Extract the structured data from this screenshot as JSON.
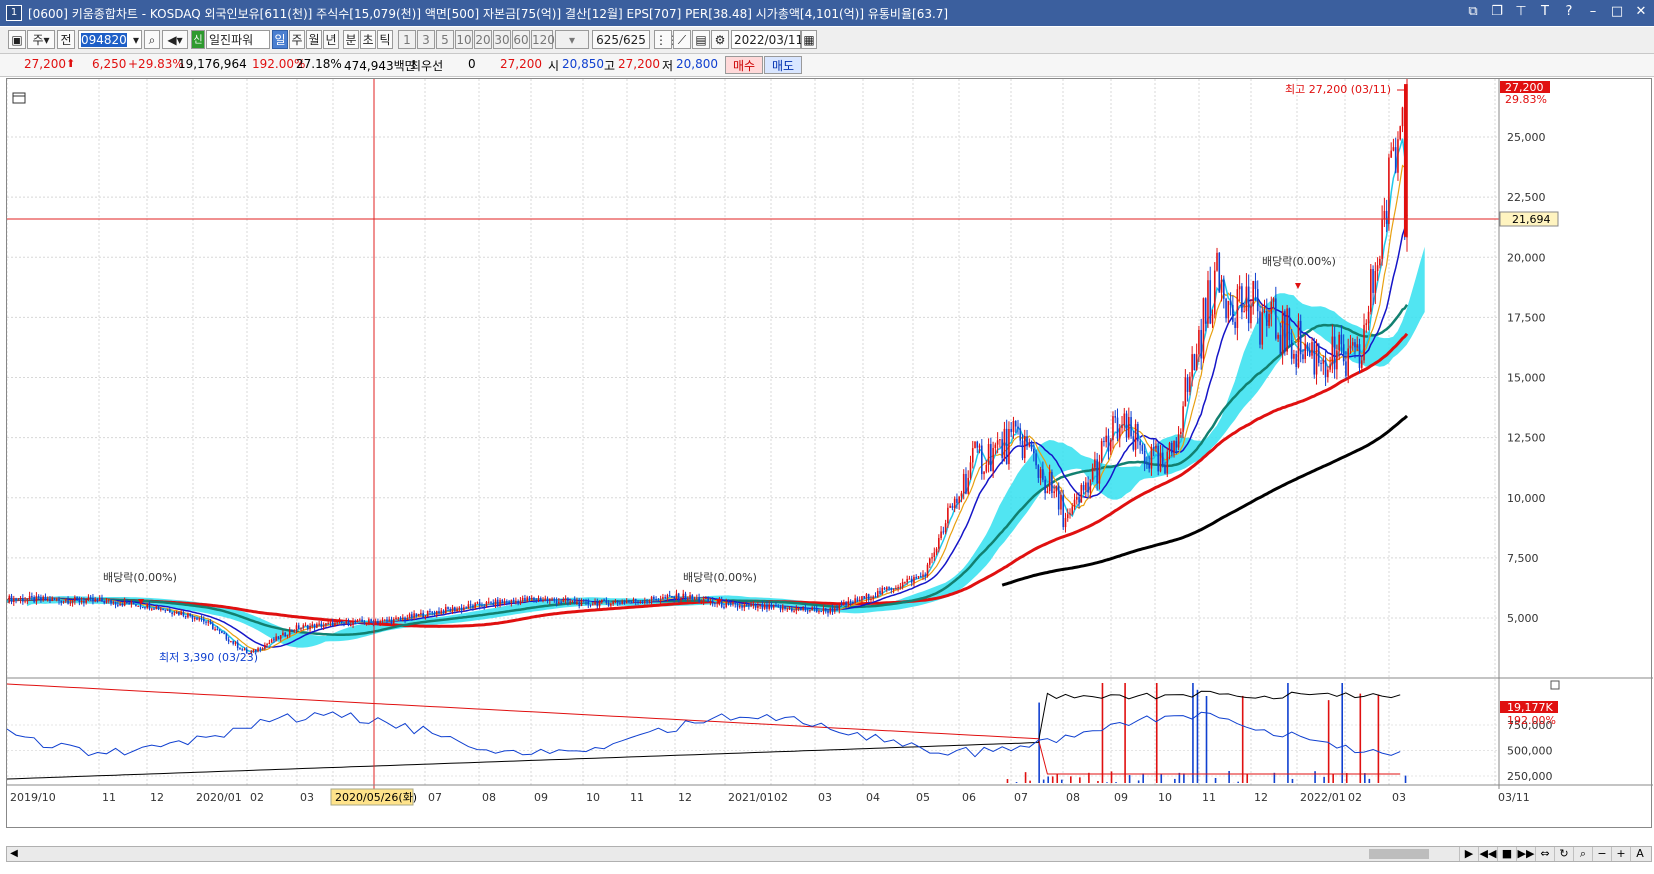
{
  "title": "[0600] 키움종합차트 - KOSDAQ 외국인보유[611(천)] 주식수[15,079(천)] 액면[500] 자본금[75(억)] 결산[12월] EPS[707] PER[38.48] 시가총액[4,101(억)] 유통비율[63.7]",
  "app_icon": "1",
  "toolbar": {
    "period_btn": "주",
    "prev_btn": "전",
    "code": "094820",
    "stock_badge": "신",
    "stock_name": "일진파워",
    "tf_day": "일",
    "tf_week": "주",
    "tf_month": "월",
    "tf_year": "년",
    "tf_min": "분",
    "tf_sec": "초",
    "tf_tick": "틱",
    "n1": "1",
    "n3": "3",
    "n5": "5",
    "n10": "10",
    "n20": "20",
    "n30": "30",
    "n60": "60",
    "n120": "120",
    "count": "625/625",
    "date": "2022/03/11"
  },
  "quote": {
    "price": "27,200",
    "change": "6,250",
    "change_pct": "+29.83%",
    "volume": "19,176,964",
    "vol_ratio": "192.00%",
    "turnover": "27.18%",
    "amount": "474,943백만",
    "label_pref": "최우선",
    "pref_val": "0",
    "ask": "27,200",
    "open_label": "시",
    "open": "20,850",
    "high_label": "고",
    "high": "27,200",
    "low_label": "저",
    "low": "20,800",
    "buy": "매수",
    "sell": "매도"
  },
  "annotations": {
    "high": "최고 27,200 (03/11)",
    "low": "최저 3,390 (03/23)",
    "div1": "배당락(0.00%)",
    "div2": "배당락(0.00%)",
    "div3": "배당락(0.00%)"
  },
  "price_labels": {
    "current": "27,200",
    "current_pct": "29.83%",
    "crosshair": "21,694",
    "vol_current": "19,177K",
    "vol_pct": "192.00%"
  },
  "x_labels": [
    "2019/10",
    "11",
    "12",
    "2020/01",
    "02",
    "03",
    "04",
    "2020/05/26(화)",
    "07",
    "08",
    "09",
    "10",
    "11",
    "12",
    "2021/01",
    "02",
    "03",
    "04",
    "05",
    "06",
    "07",
    "08",
    "09",
    "10",
    "11",
    "12",
    "2022/01",
    "02",
    "03",
    "03/11"
  ],
  "chart_data": {
    "type": "candlestick",
    "symbol": "094820",
    "name": "일진파워",
    "timeframe": "daily",
    "y_ticks": [
      5000,
      7500,
      10000,
      12500,
      15000,
      17500,
      20000,
      22500,
      25000
    ],
    "vol_ticks": [
      250000,
      500000,
      750000
    ],
    "close_series": {
      "dates": [
        "2019/10",
        "2019/11",
        "2019/12",
        "2020/01",
        "2020/02",
        "2020/03",
        "2020/04",
        "2020/05",
        "2020/06",
        "2020/07",
        "2020/08",
        "2020/09",
        "2020/10",
        "2020/11",
        "2020/12",
        "2021/01",
        "2021/02",
        "2021/03",
        "2021/04",
        "2021/05",
        "2021/06",
        "2021/07",
        "2021/08",
        "2021/09",
        "2021/10",
        "2021/11",
        "2021/12",
        "2022/01",
        "2022/02",
        "2022/03"
      ],
      "values": [
        5800,
        5750,
        5700,
        5500,
        5000,
        3500,
        4600,
        4800,
        4900,
        5300,
        5600,
        5800,
        5600,
        5700,
        5900,
        5500,
        5400,
        5300,
        6000,
        6800,
        11500,
        12500,
        9000,
        13000,
        11000,
        19000,
        17500,
        16000,
        15500,
        27200
      ]
    },
    "high": 27200,
    "low": 3390,
    "current": 27200,
    "open": 20850,
    "crosshair_price": 21694,
    "crosshair_date": "2020/05/26(화)",
    "moving_averages": [
      "5",
      "10",
      "20",
      "60",
      "120",
      "240"
    ],
    "colors": {
      "up": "#e01010",
      "down": "#1040d0",
      "ichimoku_cloud": "#33e0f0",
      "ma240": "#000000",
      "ma120": "#e01010",
      "ma60": "#128070"
    }
  }
}
